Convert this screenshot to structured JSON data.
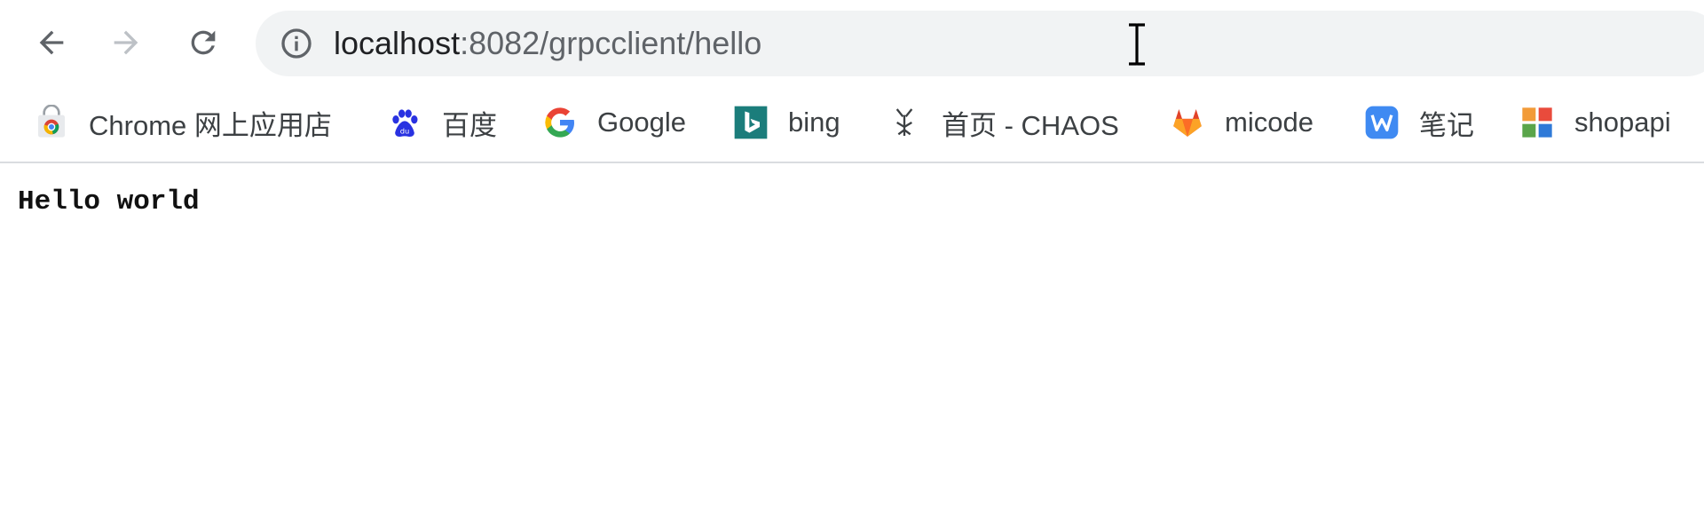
{
  "toolbar": {
    "url_host": "localhost",
    "url_rest": ":8082/grpcclient/hello"
  },
  "bookmarks": [
    {
      "label": "Chrome 网上应用店",
      "icon": "chrome-webstore-icon"
    },
    {
      "label": "百度",
      "icon": "baidu-paw-icon"
    },
    {
      "label": "Google",
      "icon": "google-g-icon"
    },
    {
      "label": "bing",
      "icon": "bing-icon"
    },
    {
      "label": "首页 - CHAOS",
      "icon": "chaos-icon"
    },
    {
      "label": "micode",
      "icon": "gitlab-icon"
    },
    {
      "label": "笔记",
      "icon": "wiz-note-icon"
    },
    {
      "label": "shopapi",
      "icon": "shopapi-icon"
    }
  ],
  "page": {
    "body_text": "Hello world"
  },
  "colors": {
    "omnibox_bg": "#f1f3f4",
    "bing_teal": "#1b7d7b",
    "gitlab_orange": "#e8642a",
    "wiz_blue": "#3f8af2"
  }
}
